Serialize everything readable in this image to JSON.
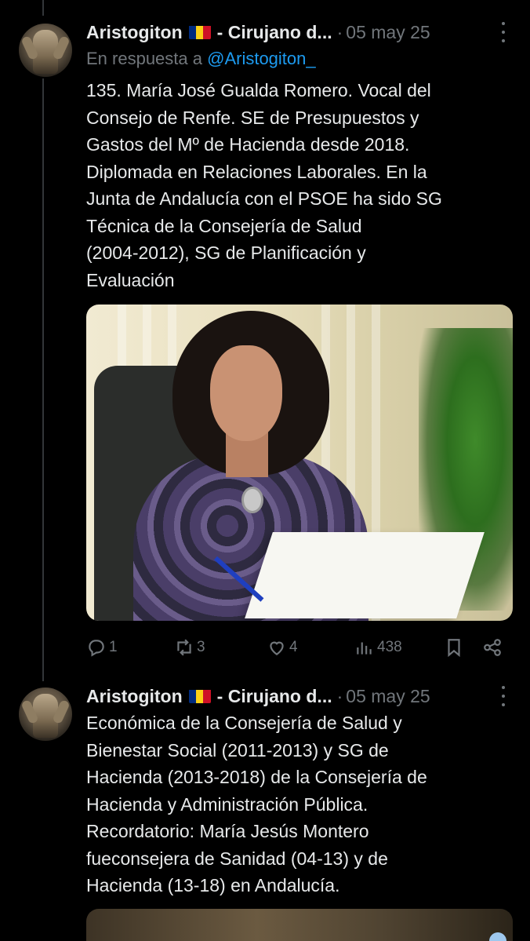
{
  "tweets": [
    {
      "author_name": "Aristogiton",
      "author_suffix": "- Cirujano d...",
      "separator": "·",
      "date": "05 may 25",
      "reply_prefix": "En respuesta a",
      "reply_handle": "@Aristogiton_",
      "text": "135. María José Gualda Romero. Vocal del\nConsejo de Renfe. SE de Presupuestos y\nGastos del Mº de Hacienda desde 2018.\nDiplomada en Relaciones Laborales. En la\nJunta de Andalucía con el PSOE ha sido SG\nTécnica de la Consejería de Salud\n(2004-2012), SG de Planificación y\nEvaluación",
      "image_alt": "photo-woman-signing-document",
      "actions": {
        "replies": "1",
        "retweets": "3",
        "likes": "4",
        "views": "438"
      }
    },
    {
      "author_name": "Aristogiton",
      "author_suffix": "- Cirujano d...",
      "separator": "·",
      "date": "05 may 25",
      "text": "Económica de la Consejería de Salud y\nBienestar Social (2011-2013) y SG de\nHacienda (2013-2018) de la Consejería de\nHacienda y Administración Pública.\nRecordatorio: María Jesús Montero\nfueconsejera de Sanidad (04-13) y de\nHacienda (13-18) en Andalucía."
    }
  ],
  "flag_colors": [
    "#002b7f",
    "#fcd116",
    "#ce1126"
  ],
  "colors": {
    "background": "#000000",
    "text": "#e7e9ea",
    "muted": "#71767b",
    "link": "#1d9bf0"
  },
  "icons": {
    "reply": "reply-icon",
    "retweet": "retweet-icon",
    "like": "heart-icon",
    "views": "views-icon",
    "bookmark": "bookmark-icon",
    "share": "share-icon",
    "more": "more-icon"
  }
}
